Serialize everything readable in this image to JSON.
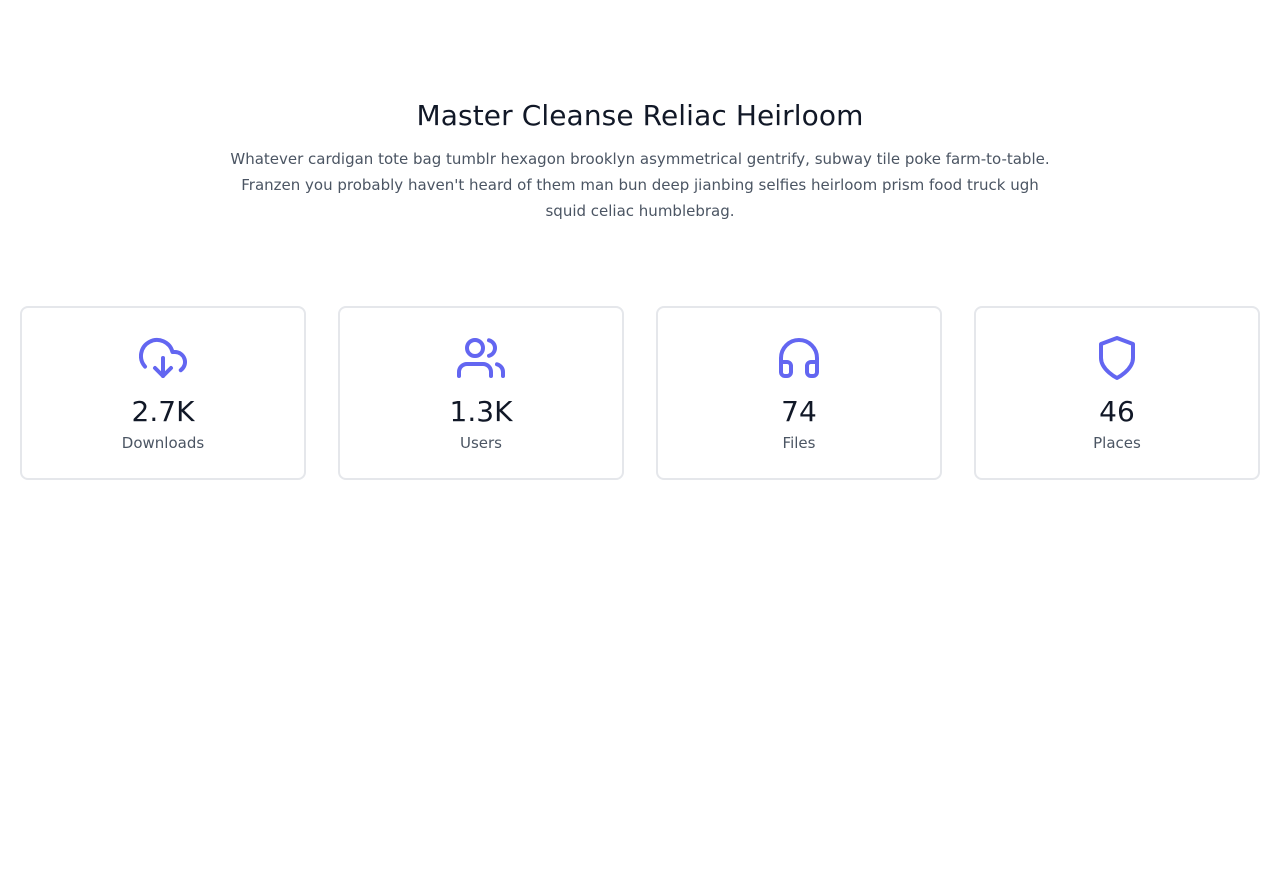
{
  "header": {
    "title": "Master Cleanse Reliac Heirloom",
    "description": "Whatever cardigan tote bag tumblr hexagon brooklyn asymmetrical gentrify, subway tile poke farm-to-table. Franzen you probably haven't heard of them man bun deep jianbing selfies heirloom prism food truck ugh squid celiac humblebrag."
  },
  "theme": {
    "accent": "#6366f1",
    "title_color": "#111827",
    "text_color": "#4b5563",
    "border_color": "#e5e7eb"
  },
  "stats": [
    {
      "icon": "cloud-download-icon",
      "value": "2.7K",
      "label": "Downloads"
    },
    {
      "icon": "users-icon",
      "value": "1.3K",
      "label": "Users"
    },
    {
      "icon": "headphones-icon",
      "value": "74",
      "label": "Files"
    },
    {
      "icon": "shield-icon",
      "value": "46",
      "label": "Places"
    }
  ]
}
